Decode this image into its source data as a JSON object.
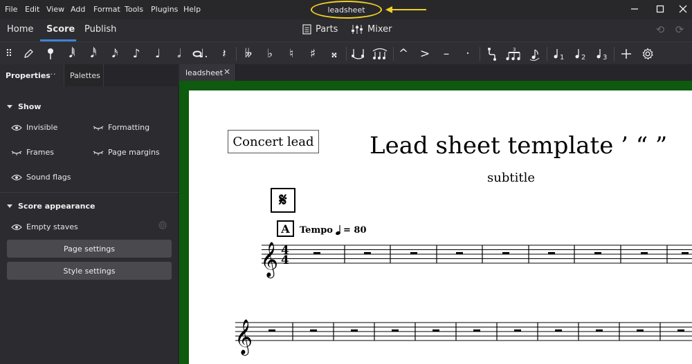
{
  "menu": [
    "File",
    "Edit",
    "View",
    "Add",
    "Format",
    "Tools",
    "Plugins",
    "Help"
  ],
  "window": {
    "title": "leadsheet",
    "highlight_color": "#f2d023"
  },
  "workspace_tabs": {
    "home": "Home",
    "score": "Score",
    "publish": "Publish"
  },
  "center_buttons": {
    "parts": "Parts",
    "mixer": "Mixer"
  },
  "panel": {
    "tab_properties": "Properties",
    "tab_palettes": "Palettes",
    "show": {
      "heading": "Show",
      "invisible": "Invisible",
      "formatting": "Formatting",
      "frames": "Frames",
      "page_margins": "Page margins",
      "sound_flags": "Sound flags"
    },
    "score_appearance": {
      "heading": "Score appearance",
      "empty_staves": "Empty staves",
      "page_settings": "Page settings",
      "style_settings": "Style settings"
    }
  },
  "document": {
    "tab_label": "leadsheet",
    "part_name": "Concert lead",
    "title": "Lead sheet template ’ “ ”",
    "subtitle": "subtitle",
    "rehearsal_mark": "A",
    "tempo_text": "Tempo",
    "tempo_value": "= 80",
    "time_signature_top": "4",
    "time_signature_bottom": "4"
  },
  "toolbar": {
    "tuplet_digit": "3",
    "voice_1": "1",
    "voice_2": "2",
    "voice_3": "3"
  },
  "colors": {
    "accent": "#3f83d6",
    "canvas": "#0e5a0e"
  }
}
